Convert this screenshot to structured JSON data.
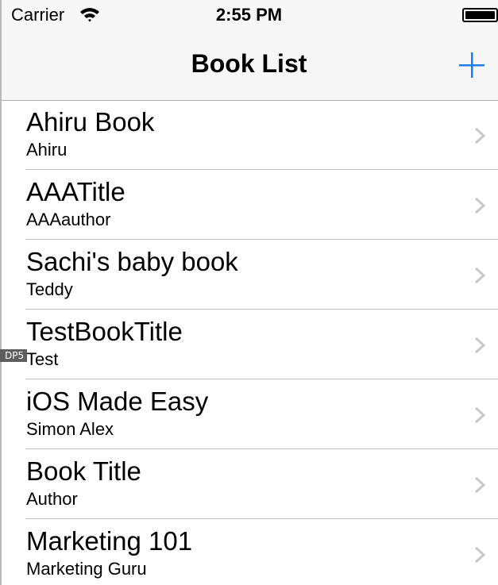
{
  "status_bar": {
    "carrier": "Carrier",
    "time": "2:55 PM",
    "wifi_icon": "wifi-icon",
    "battery_icon": "battery-full-icon"
  },
  "nav_bar": {
    "title": "Book List",
    "add_icon": "plus-icon",
    "accent_color": "#1a7df5"
  },
  "books": [
    {
      "title": "Ahiru Book",
      "author": "Ahiru"
    },
    {
      "title": "AAATitle",
      "author": "AAAauthor"
    },
    {
      "title": "Sachi's baby book",
      "author": "Teddy"
    },
    {
      "title": "TestBookTitle",
      "author": "Test"
    },
    {
      "title": "iOS Made Easy",
      "author": "Simon Alex"
    },
    {
      "title": "Book Title",
      "author": "Author"
    },
    {
      "title": "Marketing 101",
      "author": "Marketing Guru"
    }
  ],
  "overlay_tag": "DP5",
  "colors": {
    "chevron": "#c7c7cc",
    "separator": "#c8c7cc",
    "nav_background": "#f7f7f7"
  }
}
